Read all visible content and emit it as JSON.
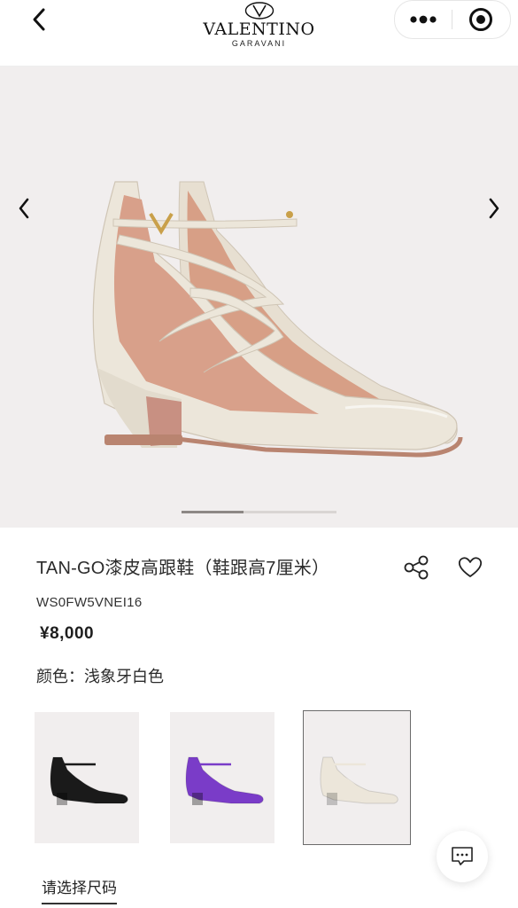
{
  "header": {
    "brand_main": "VALENTINO",
    "brand_sub": "GARAVANI",
    "brand_mark": "V",
    "back_icon": "chevron-left-icon",
    "menu_icon": "more-dots-icon",
    "close_icon": "target-circle-icon"
  },
  "gallery": {
    "prev_icon": "chevron-left-icon",
    "next_icon": "chevron-right-icon",
    "progress": 0.4,
    "product_color": "#ece6da"
  },
  "product": {
    "title": "TAN-GO漆皮高跟鞋（鞋跟高7厘米）",
    "sku": "WS0FW5VNEI16",
    "price": "¥8,000",
    "color_label": "颜色：",
    "color_value": "浅象牙白色",
    "share_icon": "share-icon",
    "favorite_icon": "heart-icon"
  },
  "swatches": [
    {
      "name": "black",
      "color": "#1a1a1a",
      "selected": false
    },
    {
      "name": "purple",
      "color": "#7a3cc8",
      "selected": false
    },
    {
      "name": "ivory",
      "color": "#ece6da",
      "selected": true
    }
  ],
  "size_select": {
    "label": "请选择尺码"
  },
  "chat": {
    "icon": "chat-bubble-icon"
  }
}
